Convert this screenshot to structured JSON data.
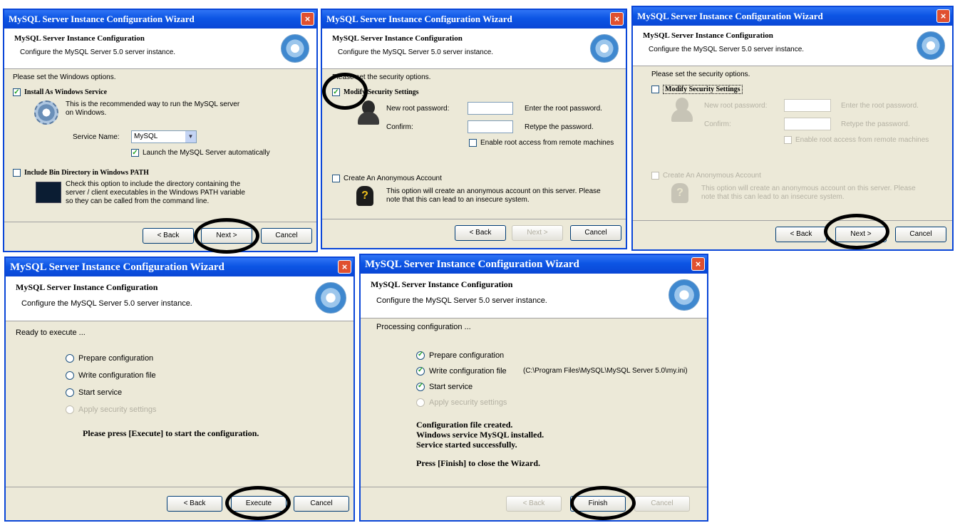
{
  "wizard_title": "MySQL Server Instance Configuration Wizard",
  "header_title": "MySQL Server Instance Configuration",
  "header_subtitle": "Configure the MySQL Server 5.0 server instance.",
  "close_glyph": "×",
  "buttons": {
    "back": "< Back",
    "next": "Next >",
    "cancel": "Cancel",
    "execute": "Execute",
    "finish": "Finish"
  },
  "win1": {
    "prompt": "Please set the Windows options.",
    "install_service": "Install As Windows Service",
    "install_service_desc_1": "This is the recommended way to run the MySQL server",
    "install_service_desc_2": "on Windows.",
    "service_name_label": "Service Name:",
    "service_name_value": "MySQL",
    "launch_auto": "Launch the MySQL Server automatically",
    "include_bin": "Include Bin Directory in Windows PATH",
    "include_bin_desc_1": "Check this option to include the directory containing the",
    "include_bin_desc_2": "server / client executables in the Windows PATH variable",
    "include_bin_desc_3": "so they can be called from the command line."
  },
  "win2": {
    "prompt": "Please set the security options.",
    "modify_security": "Modify Security Settings",
    "new_root_password": "New root password:",
    "enter_root_password": "Enter the root password.",
    "confirm": "Confirm:",
    "retype_password": "Retype the password.",
    "enable_remote": "Enable root access from remote machines",
    "anon_account": "Create An Anonymous Account",
    "anon_desc_1": "This option will create an anonymous account on this server. Please",
    "anon_desc_2": "note that this can lead to an insecure system."
  },
  "win4": {
    "ready": "Ready to execute ...",
    "steps": [
      "Prepare configuration",
      "Write configuration file",
      "Start service",
      "Apply security settings"
    ],
    "press_execute": "Please press [Execute] to start the configuration."
  },
  "win5": {
    "processing": "Processing configuration ...",
    "steps": [
      "Prepare configuration",
      "Write configuration file",
      "Start service",
      "Apply security settings"
    ],
    "config_path": "(C:\\Program Files\\MySQL\\MySQL Server 5.0\\my.ini)",
    "result_1": "Configuration file created.",
    "result_2": "Windows service MySQL installed.",
    "result_3": "Service started successfully.",
    "press_finish": "Press [Finish] to close the Wizard."
  }
}
